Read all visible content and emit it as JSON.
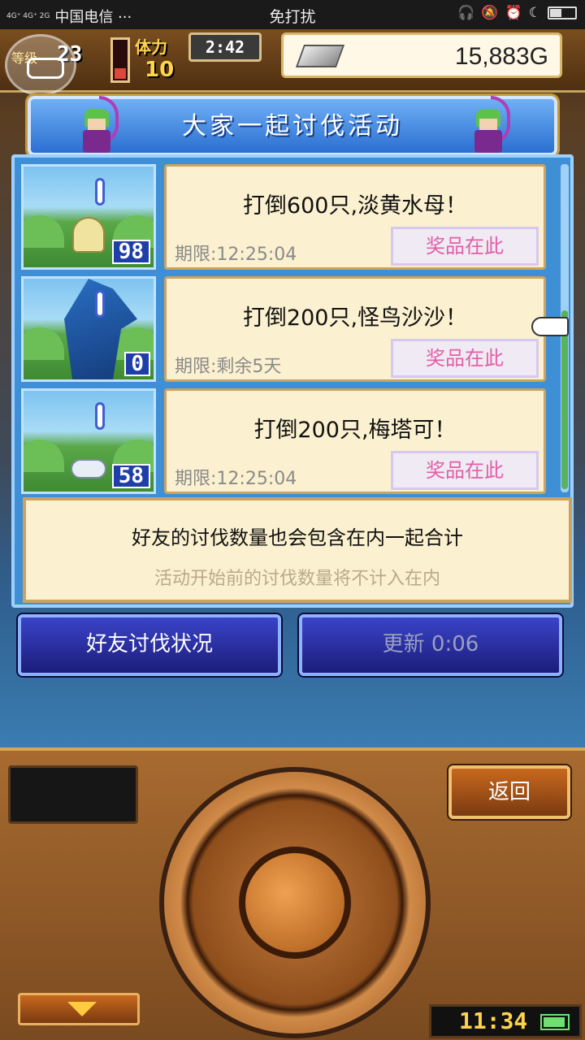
{
  "status_bar": {
    "network": "4G⁺ 4G⁺ 2G",
    "carrier": "中国电信 ···",
    "title": "免打扰",
    "icons": [
      "headphones-icon",
      "mute-icon",
      "alarm-icon",
      "moon-icon",
      "battery-icon"
    ]
  },
  "hud": {
    "level_label": "等级",
    "level": "23",
    "hp_fraction": 0.35,
    "stamina_label": "体力",
    "stamina": "10",
    "timer": "2:42",
    "gold": "15,883G"
  },
  "dialog": {
    "title": "大家一起讨伐活动",
    "quests": [
      {
        "title": "打倒600只,淡黄水母！",
        "deadline": "期限:12:25:04",
        "count": "98",
        "reward_label": "奖品在此"
      },
      {
        "title": "打倒200只,怪鸟沙沙！",
        "deadline": "期限:剩余5天",
        "count": "0",
        "reward_label": "奖品在此"
      },
      {
        "title": "打倒200只,梅塔可！",
        "deadline": "期限:12:25:04",
        "count": "58",
        "reward_label": "奖品在此"
      }
    ],
    "info_line1": "好友的讨伐数量也会包含在内一起合计",
    "info_line2": "活动开始前的讨伐数量将不计入在内"
  },
  "buttons": {
    "friends_status": "好友讨伐状况",
    "refresh": "更新 0:06"
  },
  "console": {
    "back": "返回",
    "clock": "11:34"
  },
  "colors": {
    "title_bar": "#2b6fd1",
    "card": "#fbf0cf",
    "reward_text": "#e060a8",
    "button_blue": "#1c1c7a"
  }
}
